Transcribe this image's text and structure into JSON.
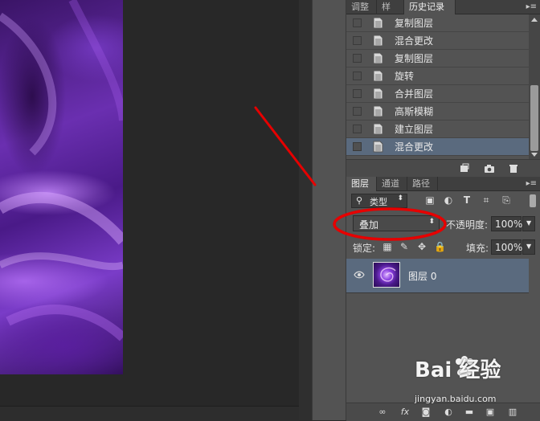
{
  "history_panel": {
    "tabs": [
      "调整",
      "样式",
      "历史记录"
    ],
    "active_tab": "历史记录",
    "items": [
      {
        "label": "复制图层",
        "selected": false
      },
      {
        "label": "混合更改",
        "selected": false
      },
      {
        "label": "复制图层",
        "selected": false
      },
      {
        "label": "旋转",
        "selected": false
      },
      {
        "label": "合并图层",
        "selected": false
      },
      {
        "label": "高斯模糊",
        "selected": false
      },
      {
        "label": "建立图层",
        "selected": false
      },
      {
        "label": "混合更改",
        "selected": true
      }
    ]
  },
  "layers_panel": {
    "tabs": [
      "图层",
      "通道",
      "路径"
    ],
    "active_tab": "图层",
    "filter_type": "类型",
    "blend_mode": "叠加",
    "opacity_label": "不透明度:",
    "opacity_value": "100%",
    "lock_label": "锁定:",
    "fill_label": "填充:",
    "fill_value": "100%",
    "layers": [
      {
        "name": "图层 0",
        "visible": true,
        "selected": true
      }
    ]
  },
  "watermark": {
    "main": "Bai 经验",
    "sub": "jingyan.baidu.com"
  },
  "colors": {
    "panel_bg": "#535353",
    "selection": "#5a6a7e",
    "annotation": "#e60000"
  },
  "icons": [
    "menu-icon",
    "document-icon",
    "new-doc-icon",
    "camera-icon",
    "trash-icon",
    "search-icon",
    "image-filter-icon",
    "adjust-filter-icon",
    "text-filter-icon",
    "shape-filter-icon",
    "smart-filter-icon",
    "lock-transparent-icon",
    "lock-paint-icon",
    "lock-move-icon",
    "lock-all-icon",
    "eye-icon",
    "link-icon",
    "fx-icon",
    "mask-icon",
    "adjustment-icon",
    "folder-icon",
    "new-layer-icon"
  ]
}
